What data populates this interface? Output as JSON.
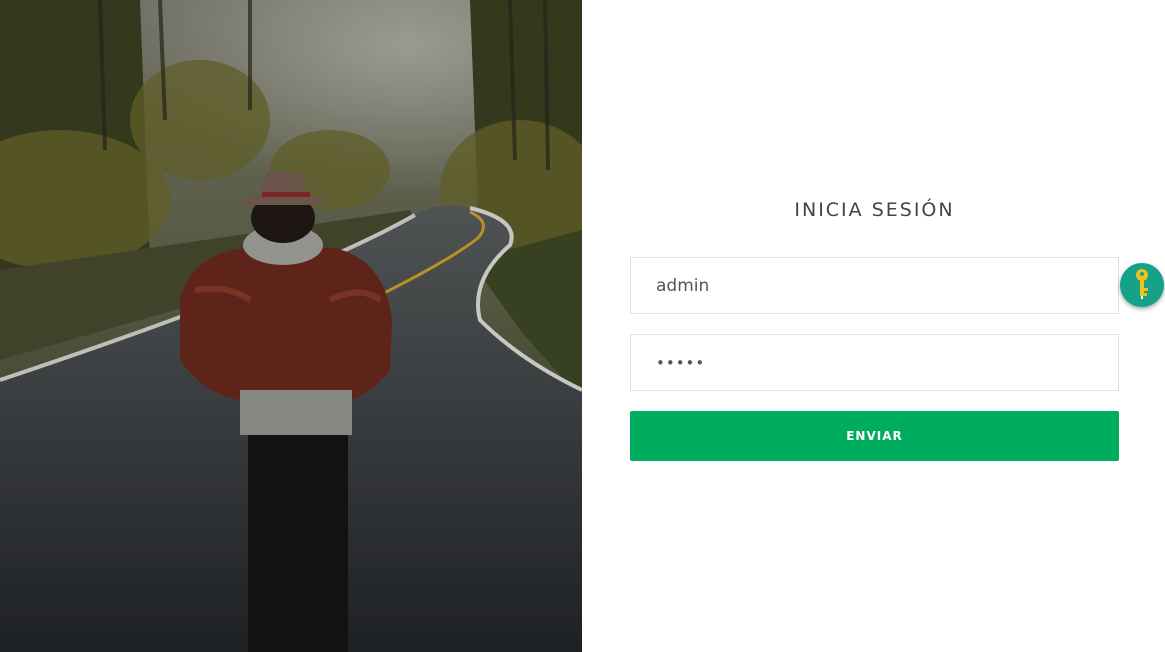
{
  "login": {
    "title": "INICIA SESIÓN",
    "username_value": "admin",
    "password_value": "•••••",
    "submit_label": "ENVIAR"
  },
  "icons": {
    "key_badge": "key-icon",
    "hero_image": "forest-road-walker-photo"
  },
  "colors": {
    "submit_bg": "#00ad5f",
    "key_badge_bg": "#14a388",
    "key_color": "#f3c21a",
    "title_color": "#444444"
  }
}
